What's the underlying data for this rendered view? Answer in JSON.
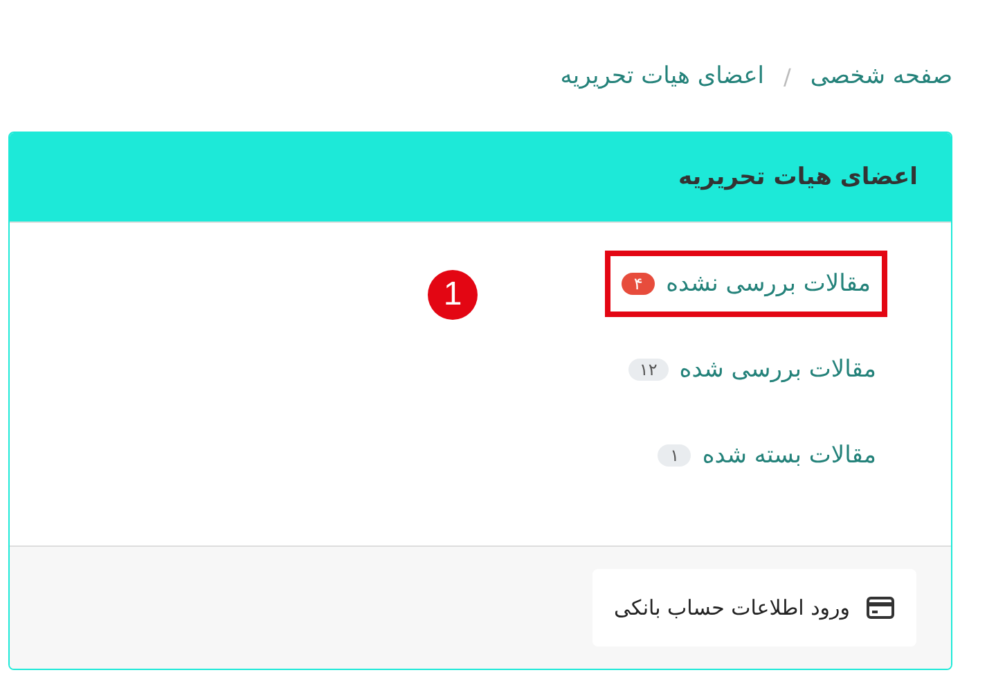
{
  "breadcrumb_separator": "/",
  "breadcrumb": [
    {
      "label": "صفحه شخصی"
    },
    {
      "label": "اعضای هیات تحریریه"
    }
  ],
  "card": {
    "title": "اعضای هیات تحریریه",
    "items": [
      {
        "label": "مقالات بررسی نشده",
        "count": "۴",
        "color": "#e74c3c",
        "highlighted": true
      },
      {
        "label": "مقالات بررسی شده",
        "count": "۱۲",
        "color": "#e9ecef",
        "highlighted": false
      },
      {
        "label": "مقالات بسته شده",
        "count": "۱",
        "color": "#e9ecef",
        "highlighted": false
      }
    ],
    "footer_button": {
      "label": "ورود اطلاعات حساب بانکی"
    }
  },
  "annotation": {
    "number": "1"
  }
}
